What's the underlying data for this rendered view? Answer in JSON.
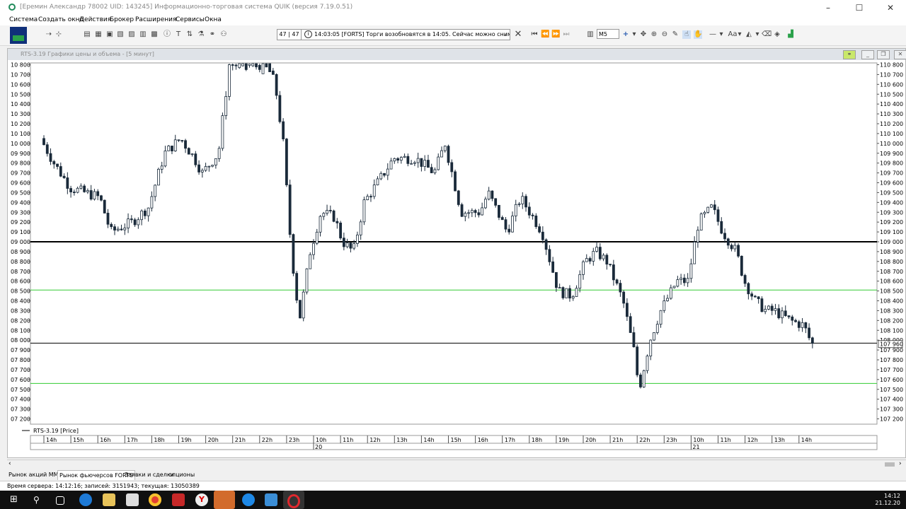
{
  "window": {
    "title": "[Еремин Александр 78002 UID: 143245] Информационно-торговая система QUIK (версия 7.19.0.51)"
  },
  "menu": [
    "Система",
    "Создать окно",
    "Действия",
    "Брокер",
    "Расширения",
    "Сервисы",
    "Окна"
  ],
  "toolbar": {
    "counter": "47 | 47",
    "message": "14:03:05  [FORTS] Торги возобновятся в 14:05. Сейчас можно снимать заявки",
    "timeframe": "M5",
    "font_label": "Aa"
  },
  "chart_window": {
    "title": "RTS-3.19 Графики цены и объема - [5 минут]"
  },
  "chart_data": {
    "type": "candlestick",
    "series": [
      {
        "name": "RTS-3.19 [Price]"
      }
    ],
    "legend": "RTS-3.19 [Price]",
    "ylim": [
      107200,
      110800
    ],
    "left_axis_ticks": [
      "10 800",
      "10 700",
      "10 600",
      "10 500",
      "10 400",
      "10 300",
      "10 200",
      "10 100",
      "10 000",
      "09 900",
      "09 800",
      "09 700",
      "09 600",
      "09 500",
      "09 400",
      "09 300",
      "09 200",
      "09 100",
      "09 000",
      "08 900",
      "08 800",
      "08 700",
      "08 600",
      "08 500",
      "08 400",
      "08 300",
      "08 200",
      "08 100",
      "08 000",
      "07 900",
      "07 800",
      "07 700",
      "07 600",
      "07 500",
      "07 400",
      "07 300",
      "07 200"
    ],
    "right_axis_ticks": [
      "110 800",
      "110 700",
      "110 600",
      "110 500",
      "110 400",
      "110 300",
      "110 200",
      "110 100",
      "110 000",
      "109 900",
      "109 800",
      "109 700",
      "109 600",
      "109 500",
      "109 400",
      "109 300",
      "109 200",
      "109 100",
      "109 000",
      "108 900",
      "108 800",
      "108 700",
      "108 600",
      "108 500",
      "108 400",
      "108 300",
      "108 200",
      "108 100",
      "108 000",
      "107 900",
      "107 800",
      "107 700",
      "107 600",
      "107 500",
      "107 400",
      "107 300",
      "107 200"
    ],
    "current_price_label": "107 960",
    "x_ticks": [
      "14h",
      "15h",
      "16h",
      "17h",
      "18h",
      "19h",
      "20h",
      "21h",
      "22h",
      "23h",
      "10h",
      "11h",
      "12h",
      "13h",
      "14h",
      "15h",
      "16h",
      "17h",
      "18h",
      "19h",
      "20h",
      "21h",
      "22h",
      "23h",
      "10h",
      "11h",
      "12h",
      "13h",
      "14h"
    ],
    "date_labels": [
      {
        "label": "20",
        "at_tick": 10
      },
      {
        "label": "21",
        "at_tick": 24
      }
    ],
    "levels": [
      {
        "price": 109000,
        "color": "#000000",
        "width": 2
      },
      {
        "price": 108510,
        "color": "#33cc33",
        "width": 1
      },
      {
        "price": 107970,
        "color": "#000000",
        "width": 1
      },
      {
        "price": 107560,
        "color": "#33cc33",
        "width": 1
      }
    ],
    "price_path": [
      [
        0,
        110050
      ],
      [
        0.5,
        109800
      ],
      [
        1.1,
        109550
      ],
      [
        2.2,
        109450
      ],
      [
        2.6,
        109100
      ],
      [
        3.4,
        109200
      ],
      [
        4.0,
        109350
      ],
      [
        4.6,
        109900
      ],
      [
        5.2,
        110050
      ],
      [
        5.7,
        109850
      ],
      [
        6.0,
        109700
      ],
      [
        6.6,
        109900
      ],
      [
        7.0,
        110800
      ],
      [
        7.6,
        110800
      ],
      [
        8.4,
        110800
      ],
      [
        8.7,
        110600
      ],
      [
        9.0,
        110000
      ],
      [
        9.3,
        108900
      ],
      [
        9.6,
        108200
      ],
      [
        10.0,
        108900
      ],
      [
        10.4,
        109300
      ],
      [
        10.9,
        109250
      ],
      [
        11.2,
        109000
      ],
      [
        11.6,
        108900
      ],
      [
        12.0,
        109400
      ],
      [
        12.5,
        109600
      ],
      [
        13.1,
        109850
      ],
      [
        13.9,
        109850
      ],
      [
        14.6,
        109700
      ],
      [
        15.0,
        110000
      ],
      [
        15.3,
        109650
      ],
      [
        15.6,
        109300
      ],
      [
        16.3,
        109300
      ],
      [
        16.6,
        109500
      ],
      [
        17.3,
        109100
      ],
      [
        17.8,
        109450
      ],
      [
        18.6,
        109100
      ],
      [
        19.2,
        108500
      ],
      [
        19.7,
        108450
      ],
      [
        20.2,
        108800
      ],
      [
        20.6,
        108900
      ],
      [
        21.0,
        108800
      ],
      [
        21.3,
        108600
      ],
      [
        21.6,
        108400
      ],
      [
        22.0,
        107900
      ],
      [
        22.2,
        107500
      ],
      [
        22.6,
        108000
      ],
      [
        23.0,
        108300
      ],
      [
        23.6,
        108600
      ],
      [
        24.0,
        108600
      ],
      [
        24.4,
        109200
      ],
      [
        24.9,
        109350
      ],
      [
        25.3,
        109100
      ],
      [
        25.8,
        108900
      ],
      [
        26.1,
        108600
      ],
      [
        26.5,
        108400
      ],
      [
        26.9,
        108300
      ],
      [
        27.2,
        108300
      ],
      [
        27.8,
        108200
      ],
      [
        28.3,
        108150
      ],
      [
        28.6,
        107960
      ]
    ]
  },
  "tabs": [
    "Рынок акций ММВБ",
    "Рынок фьючерсов FORTS",
    "Заявки и сделки",
    "опционы"
  ],
  "active_tab": 1,
  "status": "Время сервера: 14:12:16; записей: 3151943; текущая: 13050389",
  "taskbar": {
    "time": "14:12",
    "date": "21.12.20"
  }
}
